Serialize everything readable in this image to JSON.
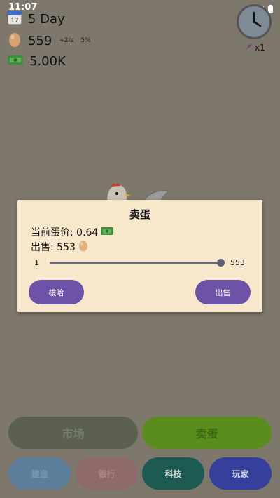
{
  "status_bar": {
    "time": "11:07"
  },
  "stats": {
    "day": "5 Day",
    "calendar_date": "17",
    "eggs": "559",
    "egg_rate": "+2/s",
    "egg_percent": "5%",
    "money": "5.00K"
  },
  "speed": {
    "label": "x1"
  },
  "modal": {
    "title": "卖蛋",
    "price_label": "当前蛋价: 0.64",
    "sell_label": "出售: 553",
    "slider": {
      "min_label": "1",
      "max_label": "553",
      "fraction": 1.0
    },
    "left_button": "梭哈",
    "right_button": "出售"
  },
  "bottom_buttons": {
    "market": "市场",
    "sell_eggs": "卖蛋",
    "build": "建造",
    "bank": "银行",
    "tech": "科技",
    "player": "玩家"
  },
  "colors": {
    "background": "#7d776c",
    "modal_bg": "#f7e8cb",
    "accent_purple": "#6d53a8",
    "market_btn": "#5b6050",
    "sell_btn": "#5b8d1e",
    "build_btn": "#5e7f9c",
    "bank_btn": "#8f6a6a",
    "tech_btn": "#1c5a52",
    "player_btn": "#363f9b"
  }
}
